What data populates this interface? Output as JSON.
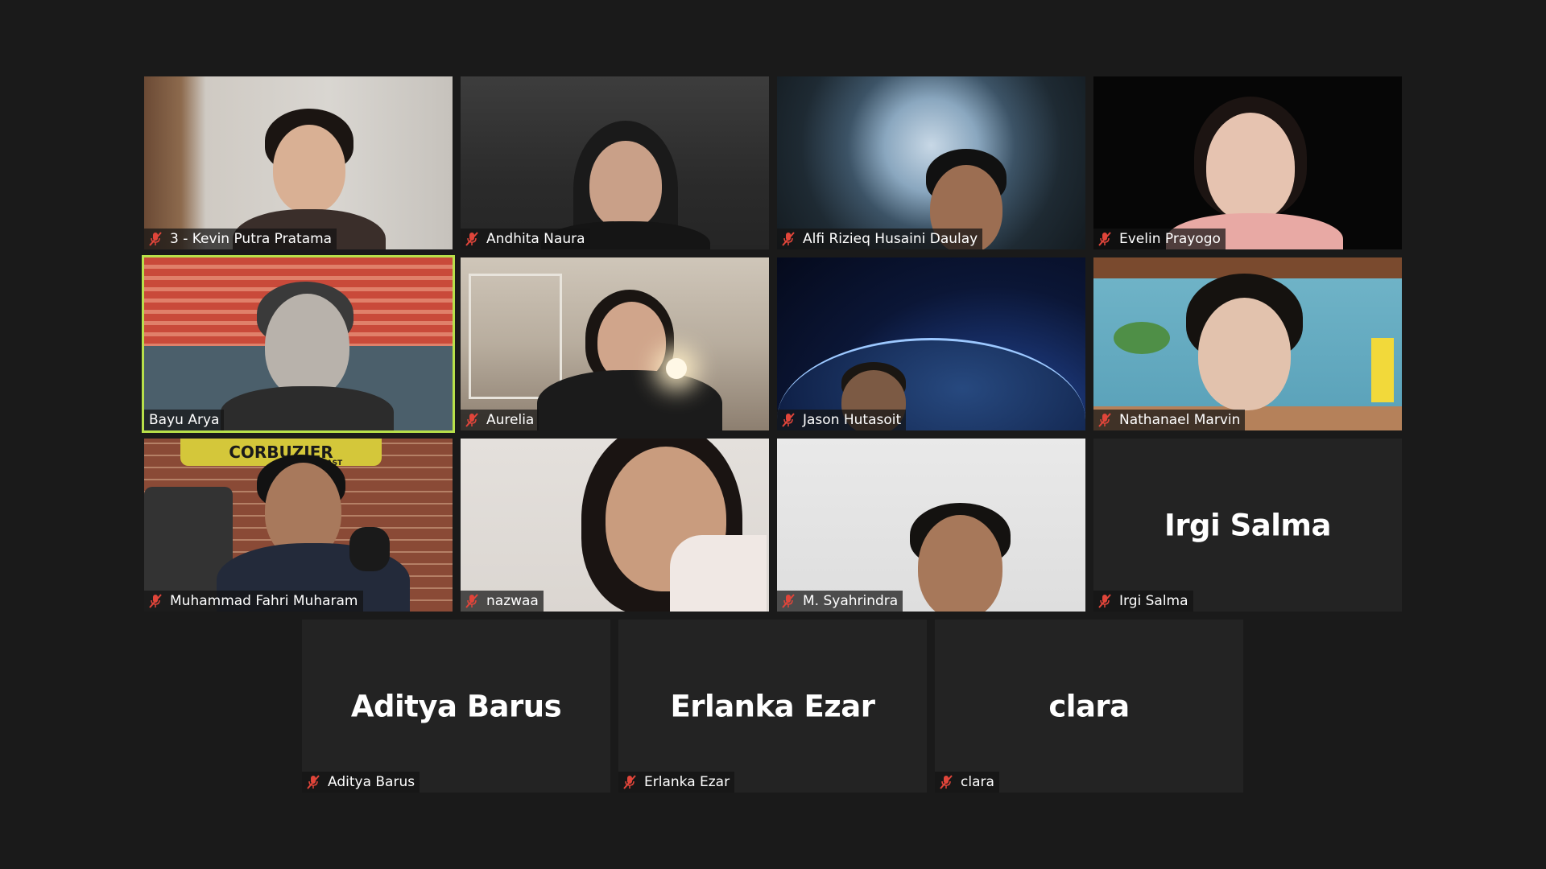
{
  "meeting": {
    "participants": [
      {
        "name": "3 - Kevin Putra Pratama",
        "video": true,
        "muted": true
      },
      {
        "name": "Andhita Naura",
        "video": true,
        "muted": true
      },
      {
        "name": "Alfi Rizieq Husaini Daulay",
        "video": true,
        "muted": true
      },
      {
        "name": "Evelin Prayogo",
        "video": true,
        "muted": true
      },
      {
        "name": "Bayu Arya",
        "video": true,
        "muted": false,
        "active_speaker": true
      },
      {
        "name": "Aurelia",
        "video": true,
        "muted": true
      },
      {
        "name": "Jason Hutasoit",
        "video": true,
        "muted": true
      },
      {
        "name": "Nathanael Marvin",
        "video": true,
        "muted": true
      },
      {
        "name": "Muhammad Fahri Muharam",
        "video": true,
        "muted": true
      },
      {
        "name": "nazwaa",
        "video": true,
        "muted": true
      },
      {
        "name": "M. Syahrindra",
        "video": true,
        "muted": true
      },
      {
        "name": "Irgi Salma",
        "video": false,
        "muted": true,
        "display_name": "Irgi Salma"
      },
      {
        "name": "Aditya Barus",
        "video": false,
        "muted": true,
        "display_name": "Aditya Barus"
      },
      {
        "name": "Erlanka Ezar",
        "video": false,
        "muted": true,
        "display_name": "Erlanka Ezar"
      },
      {
        "name": "clara",
        "video": false,
        "muted": true,
        "display_name": "clara"
      }
    ],
    "background_podcast_text": "CORBUZIER",
    "background_podcast_subtext": "CAST"
  },
  "colors": {
    "page_background": "#1a1a1a",
    "tile_background": "#232323",
    "active_speaker_border": "#b8e04a",
    "muted_icon": "#e0453a",
    "label_text": "#ffffff"
  },
  "icons": {
    "muted": "muted-mic-icon"
  }
}
